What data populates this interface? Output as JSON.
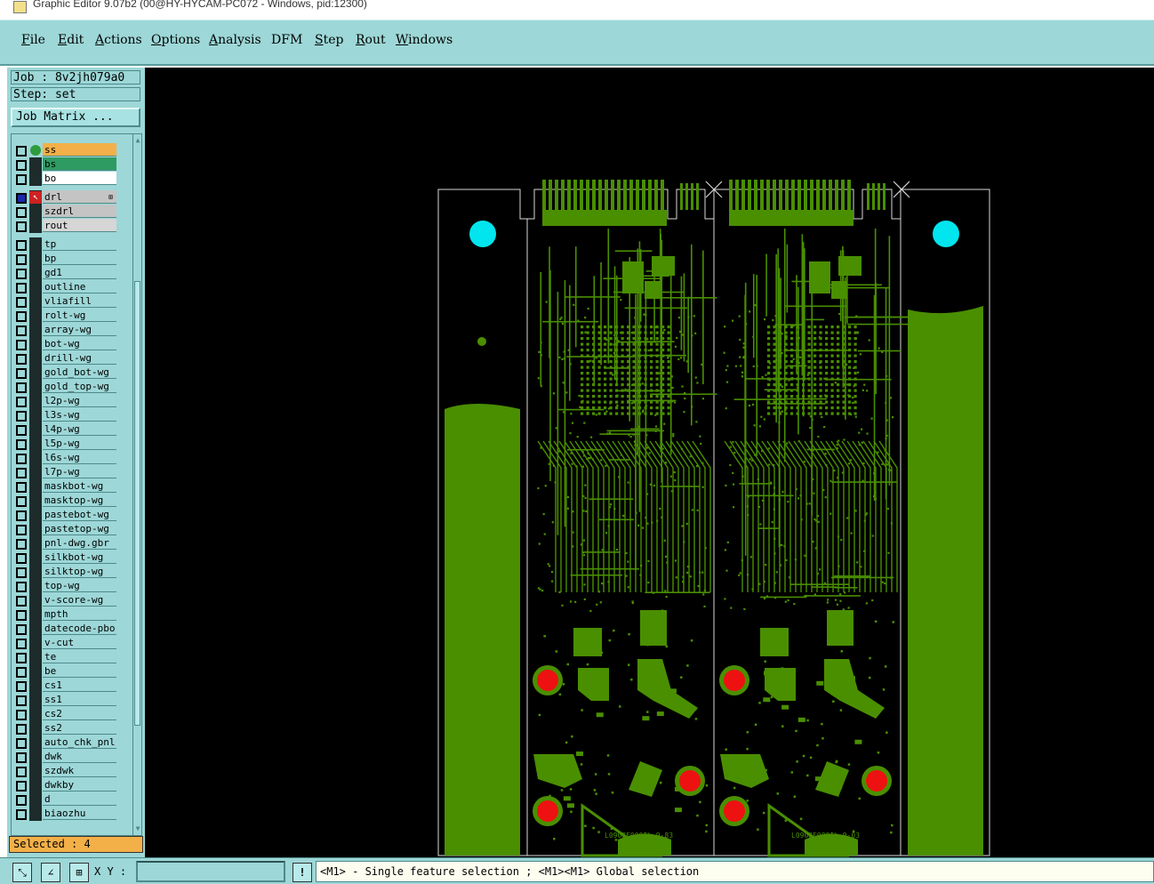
{
  "window": {
    "title": "Graphic Editor 9.07b2 (00@HY-HYCAM-PC072 - Windows, pid:12300)"
  },
  "menu": [
    "File",
    "Edit",
    "Actions",
    "Options",
    "Analysis",
    "DFM",
    "Step",
    "Rout",
    "Windows"
  ],
  "job": {
    "job_label": "Job : 8v2jh079a0",
    "step_label": "Step: set",
    "matrix_button": "Job Matrix ..."
  },
  "layers": {
    "pinned": [
      {
        "name": "ss",
        "color": "#f3b048",
        "marker": "green-dot"
      },
      {
        "name": "bs",
        "color": "#2e9b62",
        "marker": "none"
      },
      {
        "name": "bo",
        "color": "#ffffff",
        "marker": "none"
      }
    ],
    "drill": [
      {
        "name": "drl",
        "color": "#c4c4c4",
        "marker": "work-layer"
      },
      {
        "name": "szdrl",
        "color": "#c4c4c4",
        "marker": "none"
      },
      {
        "name": "rout",
        "color": "#d6d6d6",
        "marker": "none"
      }
    ],
    "regular": [
      "tp",
      "bp",
      "gd1",
      "outline",
      "vliafill",
      "rolt-wg",
      "array-wg",
      "bot-wg",
      "drill-wg",
      "gold_bot-wg",
      "gold_top-wg",
      "l2p-wg",
      "l3s-wg",
      "l4p-wg",
      "l5p-wg",
      "l6s-wg",
      "l7p-wg",
      "maskbot-wg",
      "masktop-wg",
      "pastebot-wg",
      "pastetop-wg",
      "pnl-dwg.gbr",
      "silkbot-wg",
      "silktop-wg",
      "top-wg",
      "v-score-wg",
      "mpth",
      "datecode-pbo",
      "v-cut",
      "te",
      "be",
      "cs1",
      "ss1",
      "cs2",
      "ss2",
      "auto_chk_pnl",
      "dwk",
      "szdwk",
      "dwkby",
      "d",
      "biaozhu"
    ]
  },
  "selected": "Selected : 4",
  "status": {
    "xy_label": "X Y :",
    "xy_value": "",
    "message": "<M1> - Single feature selection ; <M1><M1> Global selection",
    "alert_glyph": "!"
  },
  "pcb_text": [
    "L0908E000Ib-9-83",
    "L0908E000Ib-9-03"
  ],
  "colors": {
    "pcb_green": "#4a8f00",
    "pad_red": "#ee1111",
    "tooling_cyan": "#00e5ee"
  }
}
